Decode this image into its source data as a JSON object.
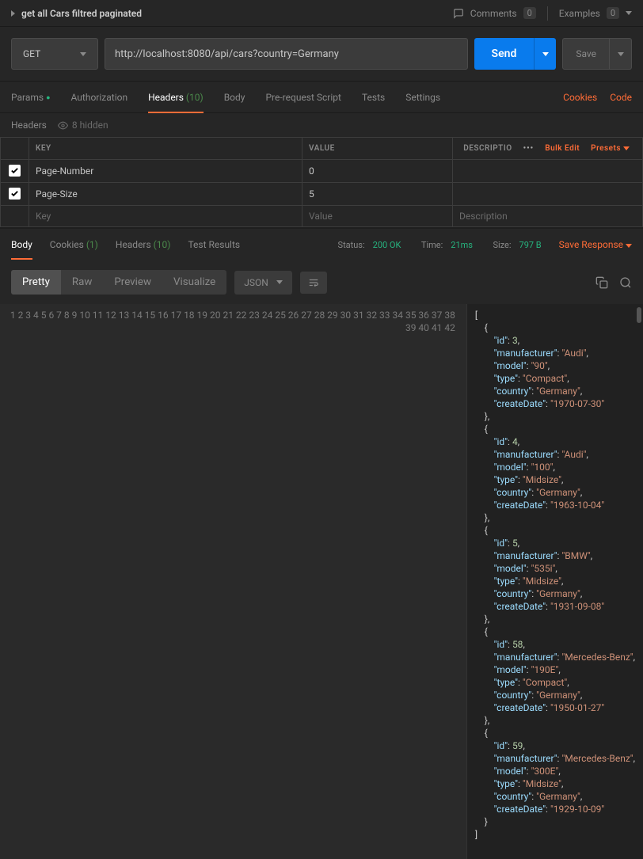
{
  "request": {
    "name": "get all Cars filtred paginated",
    "comments_label": "Comments",
    "comments_count": "0",
    "examples_label": "Examples",
    "examples_count": "0",
    "method": "GET",
    "url": "http://localhost:8080/api/cars?country=Germany",
    "send_label": "Send",
    "save_label": "Save"
  },
  "req_tabs": {
    "params": "Params",
    "authorization": "Authorization",
    "headers": "Headers",
    "headers_count": "(10)",
    "body": "Body",
    "prerequest": "Pre-request Script",
    "tests": "Tests",
    "settings": "Settings",
    "cookies_link": "Cookies",
    "code_link": "Code"
  },
  "headers_section": {
    "title": "Headers",
    "hidden_text": "8 hidden",
    "col_key": "KEY",
    "col_value": "VALUE",
    "col_desc": "DESCRIPTIO",
    "bulk_edit": "Bulk Edit",
    "presets": "Presets",
    "rows": [
      {
        "key": "Page-Number",
        "value": "0"
      },
      {
        "key": "Page-Size",
        "value": "5"
      }
    ],
    "ph_key": "Key",
    "ph_value": "Value",
    "ph_desc": "Description"
  },
  "resp_tabs": {
    "body": "Body",
    "cookies": "Cookies",
    "cookies_count": "(1)",
    "headers": "Headers",
    "headers_count": "(10)",
    "test_results": "Test Results"
  },
  "resp_meta": {
    "status_label": "Status:",
    "status_value": "200 OK",
    "time_label": "Time:",
    "time_value": "21ms",
    "size_label": "Size:",
    "size_value": "797 B",
    "save_response": "Save Response"
  },
  "body_toolbar": {
    "pretty": "Pretty",
    "raw": "Raw",
    "preview": "Preview",
    "visualize": "Visualize",
    "language": "JSON"
  },
  "response_body": [
    {
      "id": 3,
      "manufacturer": "Audi",
      "model": "90",
      "type": "Compact",
      "country": "Germany",
      "createDate": "1970-07-30"
    },
    {
      "id": 4,
      "manufacturer": "Audi",
      "model": "100",
      "type": "Midsize",
      "country": "Germany",
      "createDate": "1963-10-04"
    },
    {
      "id": 5,
      "manufacturer": "BMW",
      "model": "535i",
      "type": "Midsize",
      "country": "Germany",
      "createDate": "1931-09-08"
    },
    {
      "id": 58,
      "manufacturer": "Mercedes-Benz",
      "model": "190E",
      "type": "Compact",
      "country": "Germany",
      "createDate": "1950-01-27"
    },
    {
      "id": 59,
      "manufacturer": "Mercedes-Benz",
      "model": "300E",
      "type": "Midsize",
      "country": "Germany",
      "createDate": "1929-10-09"
    }
  ]
}
